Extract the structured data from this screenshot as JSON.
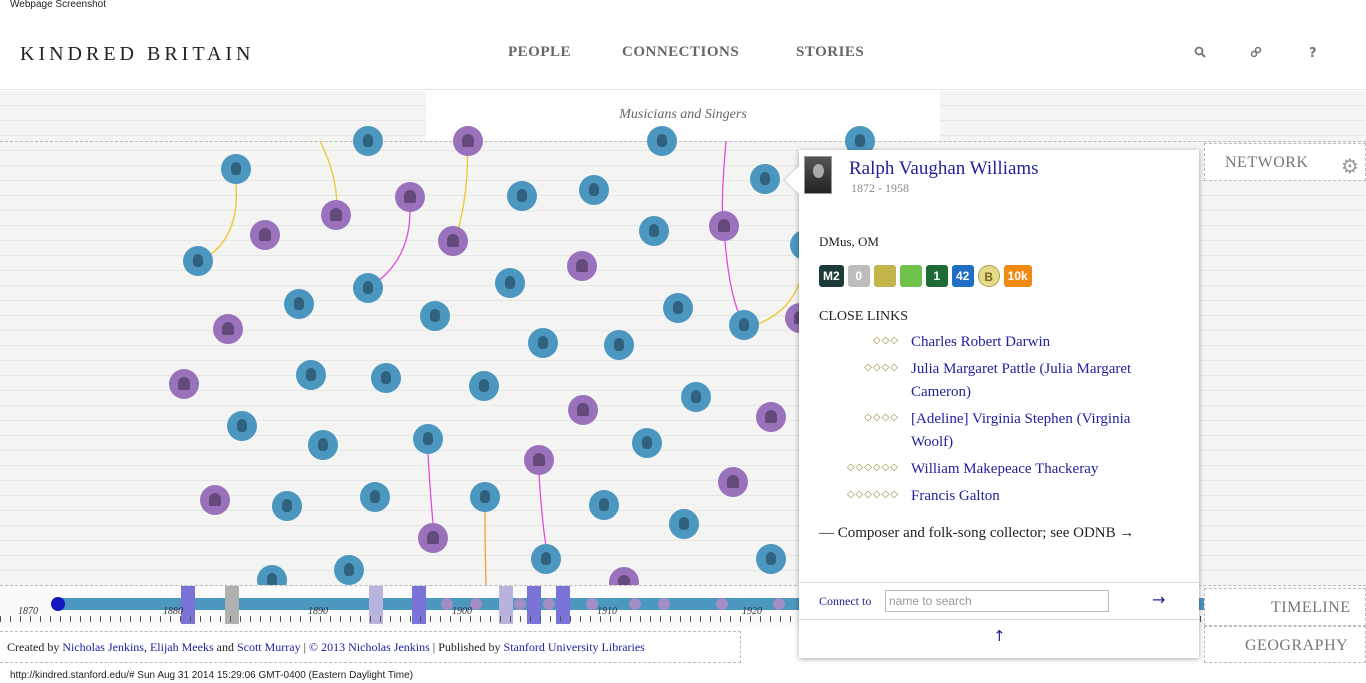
{
  "screenshot_caption": "Webpage Screenshot",
  "status_caption": "http://kindred.stanford.edu/# Sun Aug 31 2014 15:29:06 GMT-0400 (Eastern Daylight Time)",
  "header": {
    "logo": "KINDRED BRITAIN",
    "nav": [
      "PEOPLE",
      "CONNECTIONS",
      "STORIES"
    ],
    "icons": [
      "search-icon",
      "link-icon",
      "help-icon"
    ],
    "help_glyph": "?"
  },
  "collection_title": "Musicians and Singers",
  "side_tabs": {
    "network": "NETWORK",
    "timeline": "TIMELINE",
    "geography": "GEOGRAPHY"
  },
  "person": {
    "name": "Ralph Vaughan Williams",
    "dates": "1872 - 1958",
    "titles": "DMus, OM",
    "badges": [
      {
        "label": "M2",
        "color": "#1c3a3a"
      },
      {
        "label": "0",
        "color": "#bdbdbd"
      },
      {
        "label": "",
        "color": "#c2b54a"
      },
      {
        "label": "",
        "color": "#6cc24a"
      },
      {
        "label": "1",
        "color": "#1e6b36"
      },
      {
        "label": "42",
        "color": "#1f6fc4"
      },
      {
        "label": "B",
        "color": "#e4d98a"
      },
      {
        "label": "10k",
        "color": "#f08a14"
      }
    ],
    "close_links_heading": "CLOSE LINKS",
    "close_links": [
      {
        "dots": "◇◇◇",
        "name": "Charles Robert Darwin"
      },
      {
        "dots": "◇◇◇◇",
        "name": "Julia Margaret Pattle (Julia Margaret Cameron)"
      },
      {
        "dots": "◇◇◇◇",
        "name": "[Adeline] Virginia Stephen (Virginia Woolf)"
      },
      {
        "dots": "◇◇◇◇◇◇",
        "name": "William Makepeace Thackeray"
      },
      {
        "dots": "◇◇◇◇◇◇",
        "name": "Francis Galton"
      }
    ],
    "description": "— Composer and folk-song collector; see ODNB →",
    "connect_label": "Connect to",
    "connect_placeholder": "name to search",
    "connect_go": "→",
    "collapse": "↑"
  },
  "timeline": {
    "labels": [
      "1870",
      "1880",
      "1890",
      "1900",
      "1910",
      "1920"
    ]
  },
  "footer": {
    "created_by": "Created by",
    "author1": "Nicholas Jenkins",
    "author2": "Elijah Meeks",
    "and": "and",
    "author3": "Scott Murray",
    "copyright_sep": "|",
    "copyright": "© 2013 Nicholas Jenkins",
    "published_by": "| Published by",
    "publisher": "Stanford University Libraries"
  }
}
